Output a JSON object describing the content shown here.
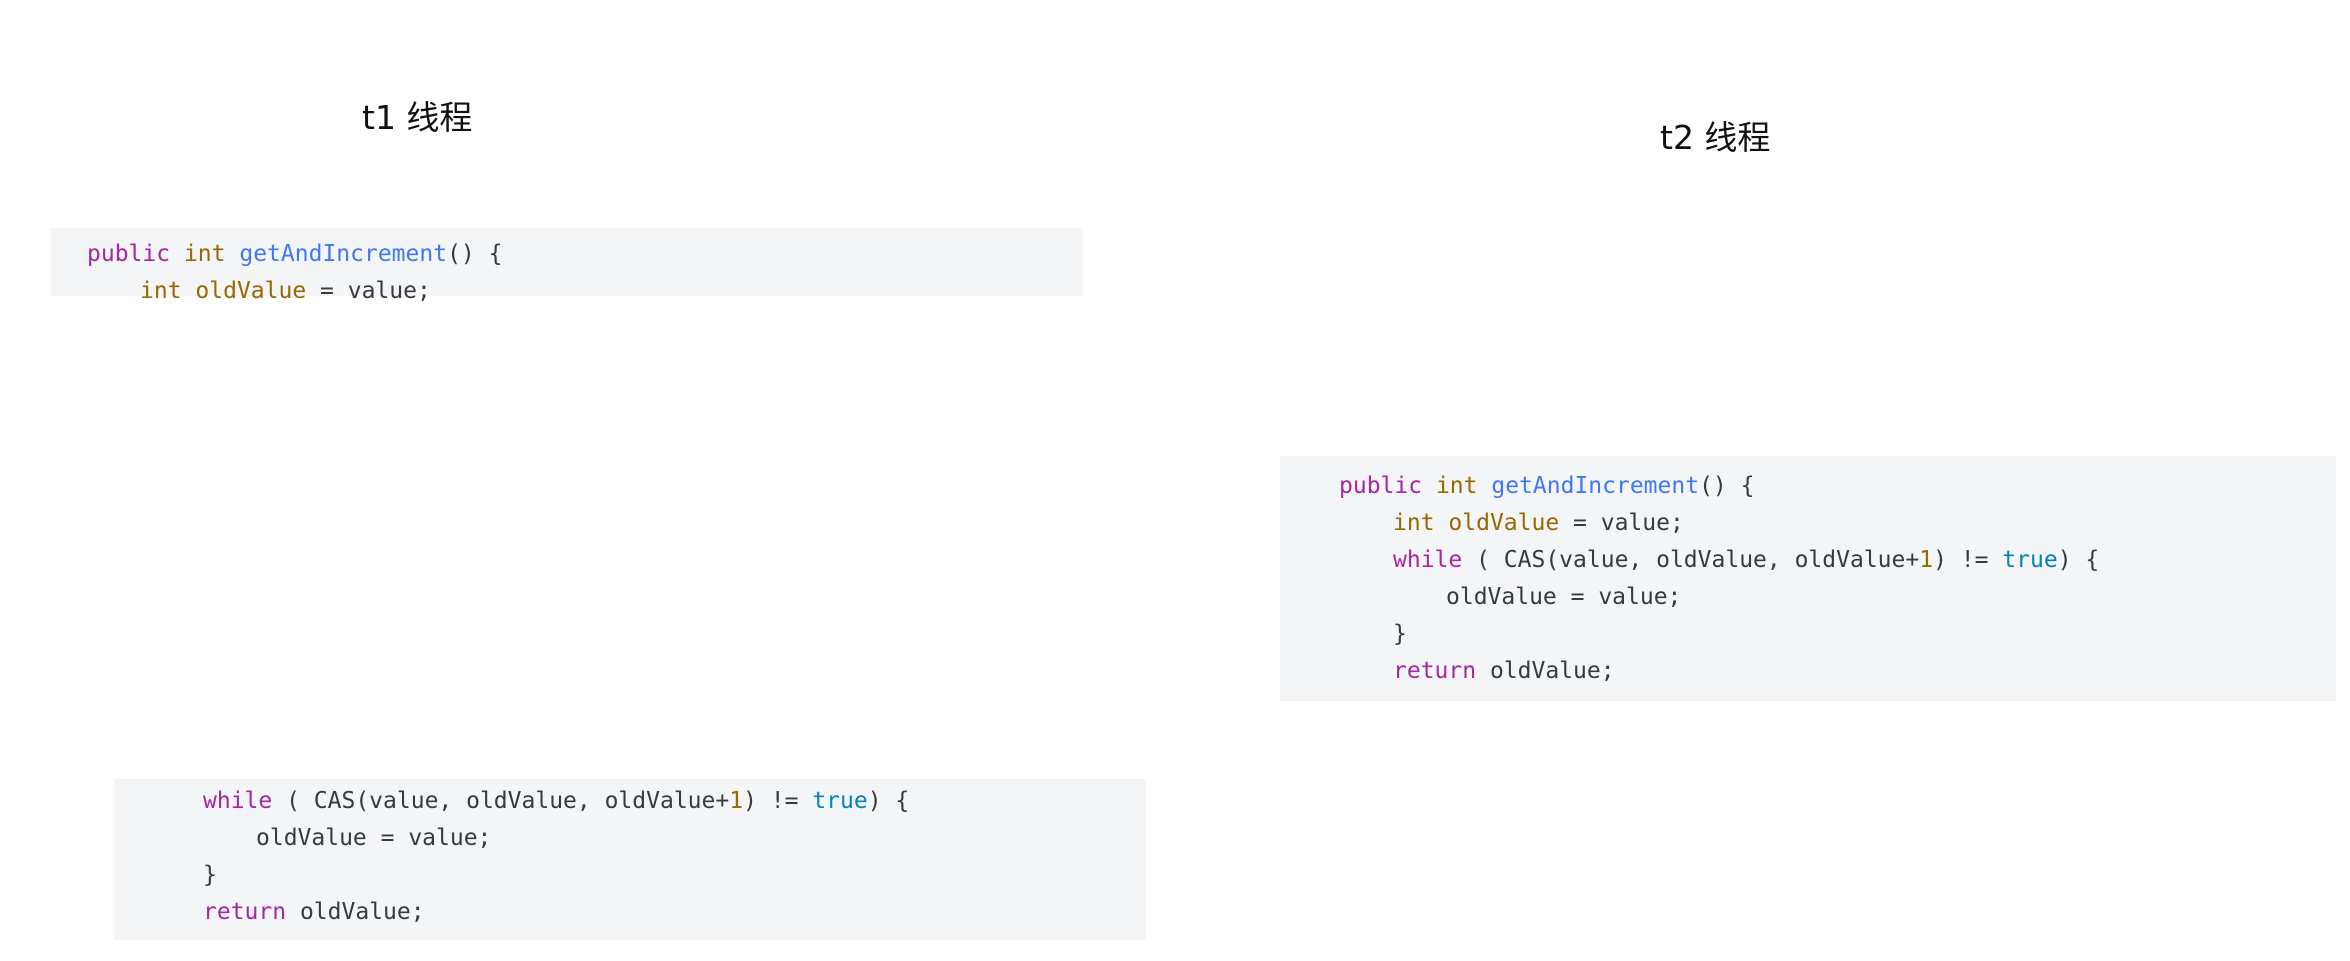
{
  "titles": {
    "t1": "t1 线程",
    "t2": "t2 线程"
  },
  "tokens": {
    "public": "public",
    "int": "int",
    "method": "getAndIncrement",
    "sig_end": "() {",
    "old_value": "oldValue",
    "assign_value": " = value;",
    "while": "while",
    "cas_open": " ( CAS(value, oldValue, oldValue+",
    "one": "1",
    "neq": ") != ",
    "true": "true",
    "while_end": ") {",
    "old_assign": "oldValue = value;",
    "close_brace": "}",
    "return": "return",
    "return_value": " oldValue;"
  },
  "colors": {
    "keyword": "#a626a4",
    "type": "#986801",
    "function": "#4078f2",
    "number": "#986801",
    "literal": "#0184bc",
    "plain": "#383a42",
    "code_background": "#f4f5f6"
  }
}
